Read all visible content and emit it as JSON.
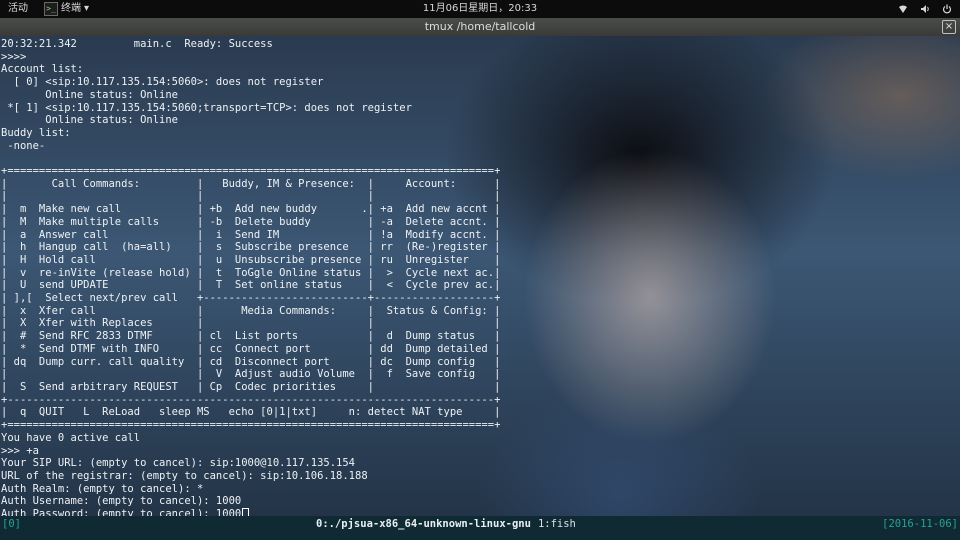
{
  "top_panel": {
    "activities": "活动",
    "app_icon_glyph": ">_",
    "app_name": "终端",
    "app_menu_arrow": "▾",
    "clock": "11月06日星期日，20:33",
    "tray_icons": [
      "network-wifi-icon",
      "volume-icon",
      "power-icon"
    ]
  },
  "window": {
    "title": "tmux /home/tallcold",
    "close_glyph": "×"
  },
  "terminal": {
    "lines": [
      "20:32:21.342         main.c  Ready: Success",
      ">>>>",
      "Account list:",
      "  [ 0] <sip:10.117.135.154:5060>: does not register",
      "       Online status: Online",
      " *[ 1] <sip:10.117.135.154:5060;transport=TCP>: does not register",
      "       Online status: Online",
      "Buddy list:",
      " -none-",
      "",
      "+=============================================================================+",
      "|       Call Commands:         |   Buddy, IM & Presence:  |     Account:      |",
      "|                              |                          |                   |",
      "|  m  Make new call            | +b  Add new buddy       .| +a  Add new accnt |",
      "|  M  Make multiple calls      | -b  Delete buddy         | -a  Delete accnt. |",
      "|  a  Answer call              |  i  Send IM              | !a  Modify accnt. |",
      "|  h  Hangup call  (ha=all)    |  s  Subscribe presence   | rr  (Re-)register |",
      "|  H  Hold call                |  u  Unsubscribe presence | ru  Unregister    |",
      "|  v  re-inVite (release hold) |  t  ToGgle Online status |  >  Cycle next ac.|",
      "|  U  send UPDATE              |  T  Set online status    |  <  Cycle prev ac.|",
      "| ],[  Select next/prev call   +--------------------------+-------------------+",
      "|  x  Xfer call                |      Media Commands:     |  Status & Config: |",
      "|  X  Xfer with Replaces       |                          |                   |",
      "|  #  Send RFC 2833 DTMF       | cl  List ports           |  d  Dump status   |",
      "|  *  Send DTMF with INFO      | cc  Connect port         | dd  Dump detailed |",
      "| dq  Dump curr. call quality  | cd  Disconnect port      | dc  Dump config   |",
      "|                              |  V  Adjust audio Volume  |  f  Save config   |",
      "|  S  Send arbitrary REQUEST   | Cp  Codec priorities     |                   |",
      "+-----------------------------------------------------------------------------+",
      "|  q  QUIT   L  ReLoad   sleep MS   echo [0|1|txt]     n: detect NAT type     |",
      "+=============================================================================+",
      "You have 0 active call",
      ">>> +a",
      "Your SIP URL: (empty to cancel): sip:1000@10.117.135.154",
      "URL of the registrar: (empty to cancel): sip:10.106.18.188",
      "Auth Realm: (empty to cancel): *",
      "Auth Username: (empty to cancel): 1000",
      "Auth Password: (empty to cancel): 1000"
    ]
  },
  "tmux": {
    "session": "[0]",
    "active_window": "0:./pjsua-x86_64-unknown-linux-gnu",
    "other_window": "1:fish",
    "date": "[2016-11-06]"
  }
}
